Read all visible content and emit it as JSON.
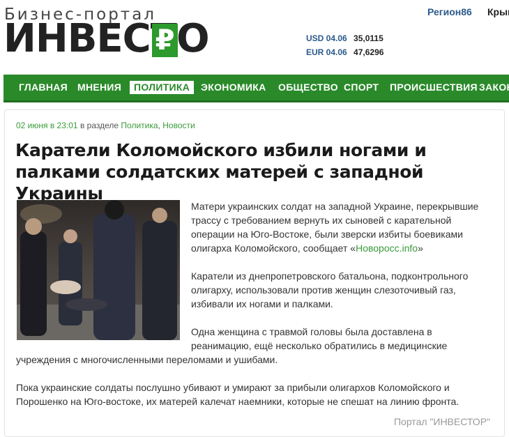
{
  "header": {
    "logo_top": "Бизнес-портал",
    "logo_main": "ИНВЕСТО",
    "logo_symbol": "₽",
    "region_link": "Регион86",
    "crimea_link": "Крым",
    "rates": [
      {
        "label": "USD 04.06",
        "value": "35,0115"
      },
      {
        "label": "EUR 04.06",
        "value": "47,6296"
      }
    ]
  },
  "nav": {
    "items": [
      {
        "label": "ГЛАВНАЯ",
        "active": false
      },
      {
        "label": "МНЕНИЯ",
        "active": false
      },
      {
        "label": "ПОЛИТИКА",
        "active": true
      },
      {
        "label": "ЭКОНОМИКА",
        "active": false
      },
      {
        "label": "ОБЩЕСТВО",
        "active": false
      },
      {
        "label": "СПОРТ",
        "active": false
      },
      {
        "label": "ПРОИСШЕСТВИЯ",
        "active": false
      },
      {
        "label": "ЗАКОН",
        "active": false
      }
    ]
  },
  "article": {
    "date": "02 июня в 23:01",
    "section_prefix": "в разделе",
    "section_1": "Политика",
    "section_sep": ",",
    "section_2": "Новости",
    "title": "Каратели Коломойского избили ногами и палками солдатских матерей с западной Украины",
    "p1_text": "Матери украинских солдат на западной Украине, перекрывшие трассу с требованием вернуть их сыновей с карательной операции на Юго-Востоке, были зверски избиты боевиками олигарха Коломойского, сообщает «",
    "p1_link": "Новоросс.info",
    "p1_end": "»",
    "p2": "Каратели из днепропетровского батальона, подконтрольного олигарху, использовали против женщин слезоточивый газ, избивали их ногами и палками.",
    "p3a": "Одна женщина с травмой головы была доставлена в реанимацию, ещё несколько обратились в медицинские",
    "p3b": "учреждения с многочисленными переломами и ушибами.",
    "p4": "Пока украинские солдаты послушно убивают и умирают за прибыли олигархов Коломойского и Порошенко на Юго-востоке, их матерей калечат наемники, которые не спешат на линию фронта.",
    "signature": "Портал \"ИНВЕСТОР\""
  },
  "colors": {
    "brand_green": "#2a8a2a",
    "link_green": "#3a9a3a",
    "region_blue": "#2b5a8a"
  }
}
